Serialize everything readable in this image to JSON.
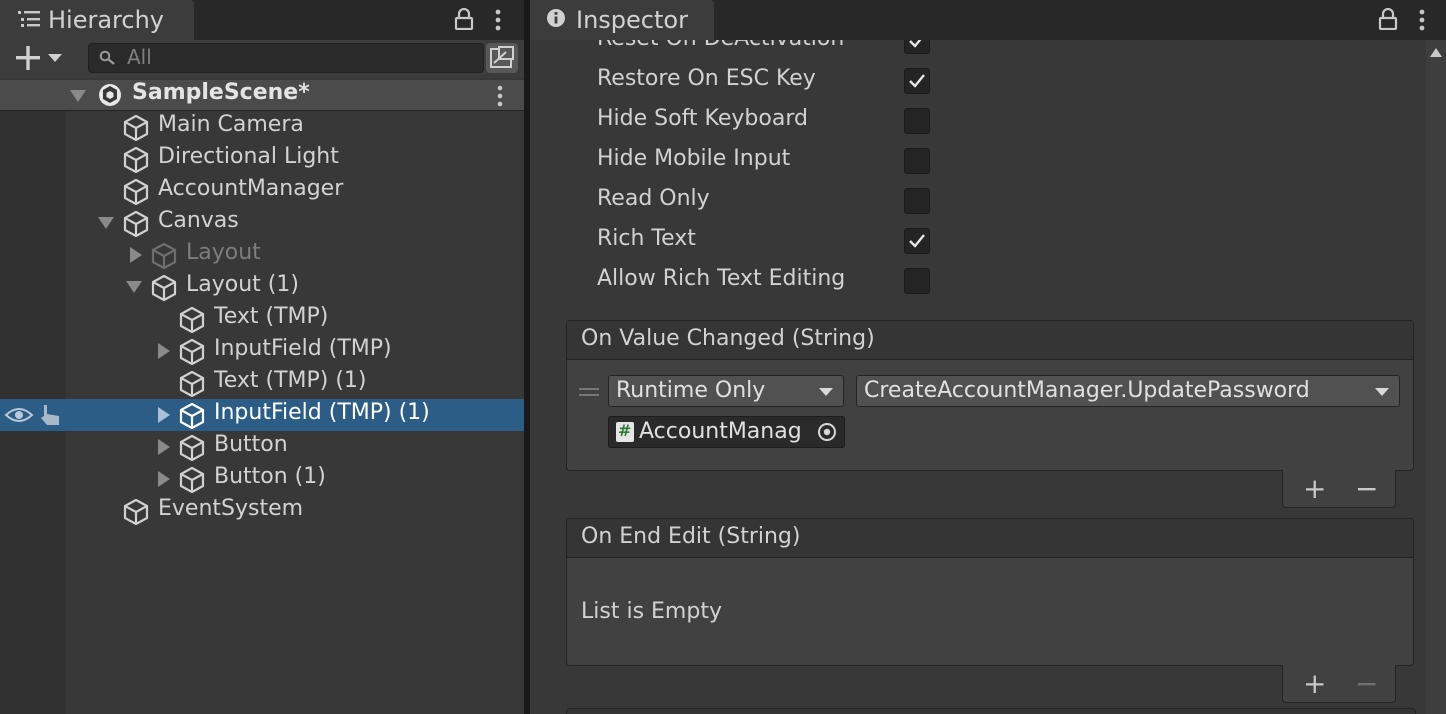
{
  "hierarchy": {
    "tab_label": "Hierarchy",
    "search_placeholder": "All",
    "scene_name": "SampleScene*",
    "items": [
      {
        "label": "Main Camera"
      },
      {
        "label": "Directional Light"
      },
      {
        "label": "AccountManager"
      },
      {
        "label": "Canvas"
      },
      {
        "label": "Layout"
      },
      {
        "label": "Layout (1)"
      },
      {
        "label": "Text (TMP)"
      },
      {
        "label": "InputField (TMP)"
      },
      {
        "label": "Text (TMP) (1)"
      },
      {
        "label": "InputField (TMP) (1)"
      },
      {
        "label": "Button"
      },
      {
        "label": "Button (1)"
      },
      {
        "label": "EventSystem"
      }
    ]
  },
  "inspector": {
    "tab_label": "Inspector",
    "properties": [
      {
        "label": "Reset On DeActivation",
        "checked": true
      },
      {
        "label": "Restore On ESC Key",
        "checked": true
      },
      {
        "label": "Hide Soft Keyboard",
        "checked": false
      },
      {
        "label": "Hide Mobile Input",
        "checked": false
      },
      {
        "label": "Read Only",
        "checked": false
      },
      {
        "label": "Rich Text",
        "checked": true
      },
      {
        "label": "Allow Rich Text Editing",
        "checked": false
      }
    ],
    "on_value_changed": {
      "title": "On Value Changed (String)",
      "runtime_option": "Runtime Only",
      "function": "CreateAccountManager.UpdatePassword",
      "object": "AccountManag"
    },
    "on_end_edit": {
      "title": "On End Edit (String)",
      "empty_text": "List is Empty"
    },
    "plus": "+",
    "minus": "−"
  },
  "colors": {
    "selected_row": "#2c5d87",
    "panel": "#383838",
    "script_icon": "#2f7a3a"
  }
}
